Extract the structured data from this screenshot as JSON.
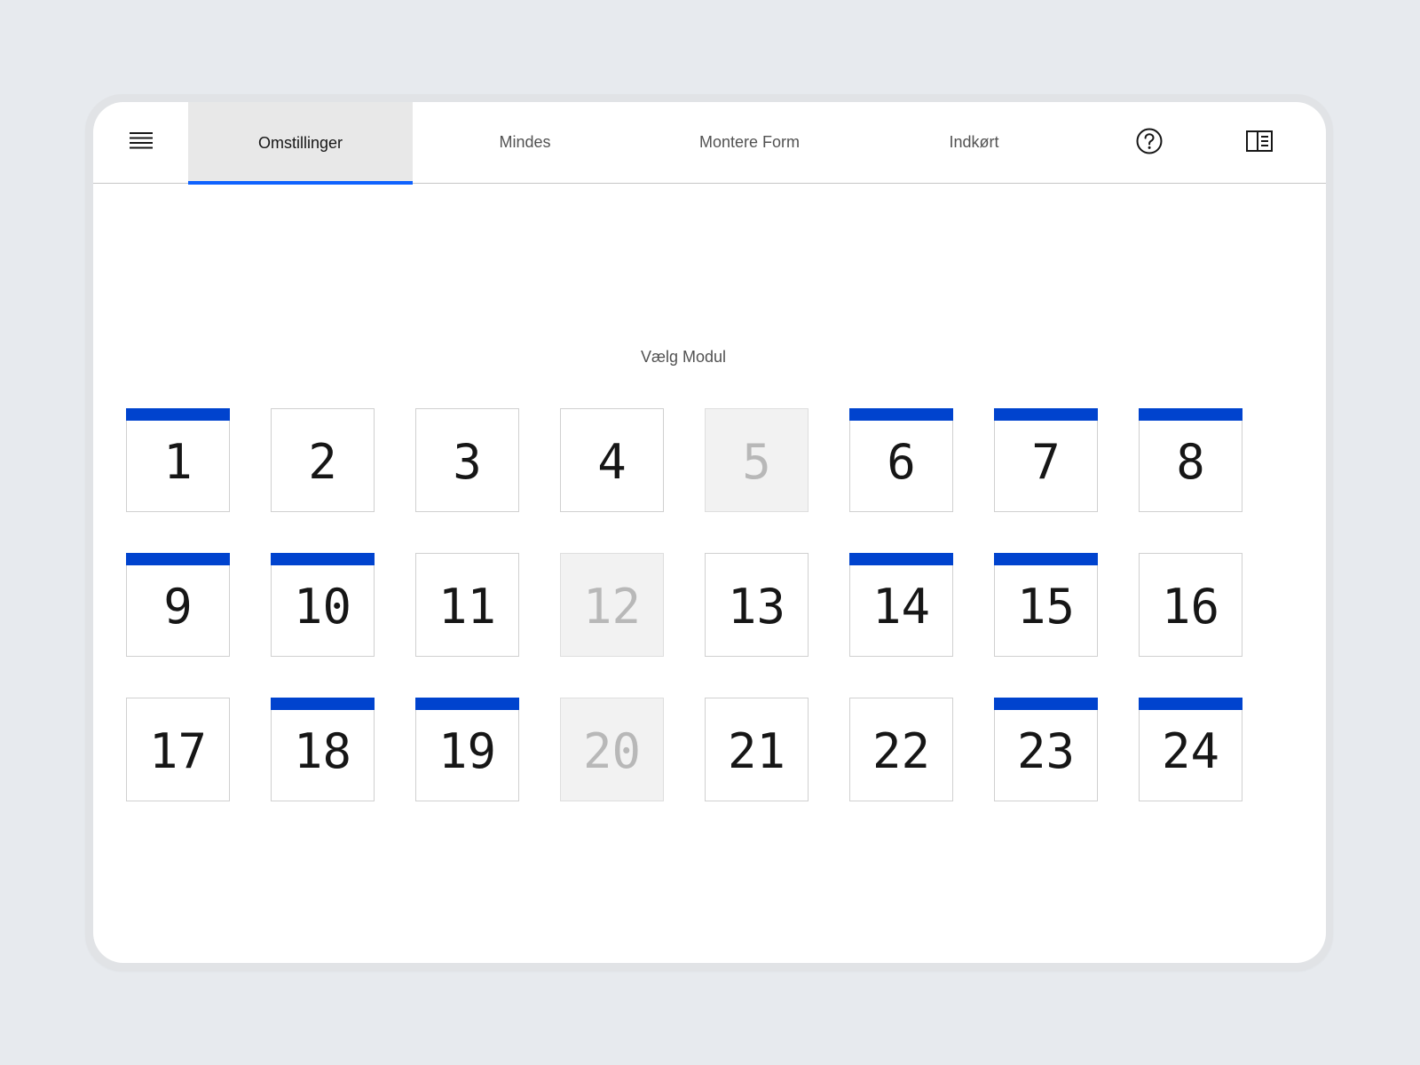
{
  "nav": {
    "tabs": [
      {
        "label": "Omstillinger",
        "active": true
      },
      {
        "label": "Mindes",
        "active": false
      },
      {
        "label": "Montere Form",
        "active": false
      },
      {
        "label": "Indkørt",
        "active": false
      }
    ],
    "icons": {
      "menu": "hamburger-menu-icon",
      "help": "help-icon",
      "panel": "side-panel-icon"
    }
  },
  "main": {
    "title": "Vælg Modul",
    "modules": [
      {
        "number": "1",
        "marked": true,
        "disabled": false
      },
      {
        "number": "2",
        "marked": false,
        "disabled": false
      },
      {
        "number": "3",
        "marked": false,
        "disabled": false
      },
      {
        "number": "4",
        "marked": false,
        "disabled": false
      },
      {
        "number": "5",
        "marked": false,
        "disabled": true
      },
      {
        "number": "6",
        "marked": true,
        "disabled": false
      },
      {
        "number": "7",
        "marked": true,
        "disabled": false
      },
      {
        "number": "8",
        "marked": true,
        "disabled": false
      },
      {
        "number": "9",
        "marked": true,
        "disabled": false
      },
      {
        "number": "10",
        "marked": true,
        "disabled": false
      },
      {
        "number": "11",
        "marked": false,
        "disabled": false
      },
      {
        "number": "12",
        "marked": false,
        "disabled": true
      },
      {
        "number": "13",
        "marked": false,
        "disabled": false
      },
      {
        "number": "14",
        "marked": true,
        "disabled": false
      },
      {
        "number": "15",
        "marked": true,
        "disabled": false
      },
      {
        "number": "16",
        "marked": false,
        "disabled": false
      },
      {
        "number": "17",
        "marked": false,
        "disabled": false
      },
      {
        "number": "18",
        "marked": true,
        "disabled": false
      },
      {
        "number": "19",
        "marked": true,
        "disabled": false
      },
      {
        "number": "20",
        "marked": false,
        "disabled": true
      },
      {
        "number": "21",
        "marked": false,
        "disabled": false
      },
      {
        "number": "22",
        "marked": false,
        "disabled": false
      },
      {
        "number": "23",
        "marked": true,
        "disabled": false
      },
      {
        "number": "24",
        "marked": true,
        "disabled": false
      }
    ]
  },
  "colors": {
    "accent": "#0f62fe",
    "marker": "#0043ce",
    "background": "#e7eaee",
    "disabled_fill": "#f2f2f2",
    "disabled_text": "#b8b8b8"
  }
}
